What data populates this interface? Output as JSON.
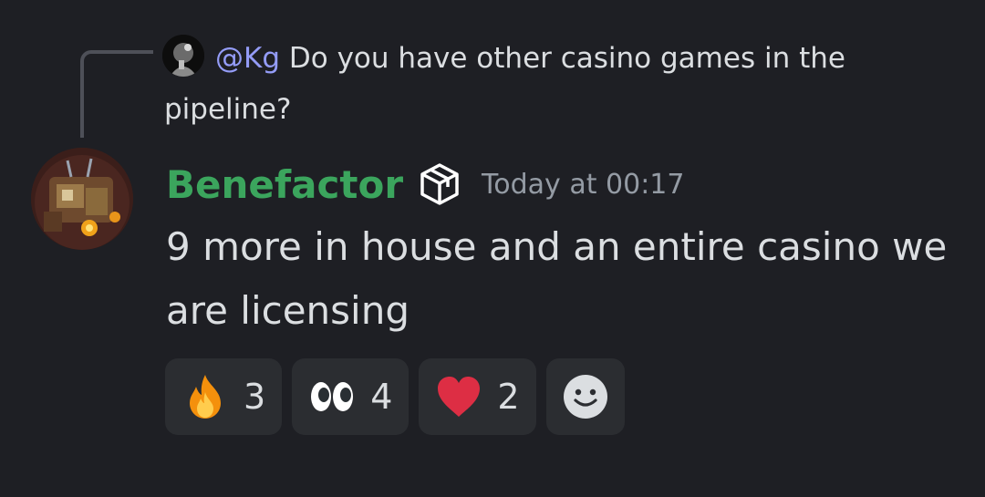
{
  "reply": {
    "mention": "@Kg",
    "text": "Do you have other casino games in the pipeline?",
    "avatar_icon": "user-avatar-icon"
  },
  "message": {
    "username": "Benefactor",
    "username_color": "#3ba55d",
    "badge_icon": "cube-badge-icon",
    "timestamp": "Today at 00:17",
    "content": "9 more in house and an entire casino we are licensing",
    "avatar_icon": "bot-avatar-icon"
  },
  "reactions": [
    {
      "emoji": "fire-emoji",
      "count": "3"
    },
    {
      "emoji": "eyes-emoji",
      "count": "4"
    },
    {
      "emoji": "heart-emoji",
      "count": "2"
    }
  ],
  "add_reaction_icon": "smiley-icon",
  "colors": {
    "background": "#1e1f24",
    "mention": "#949cf7",
    "text": "#dbdee1",
    "muted": "#949ba4",
    "reaction_bg": "#2b2d31"
  }
}
